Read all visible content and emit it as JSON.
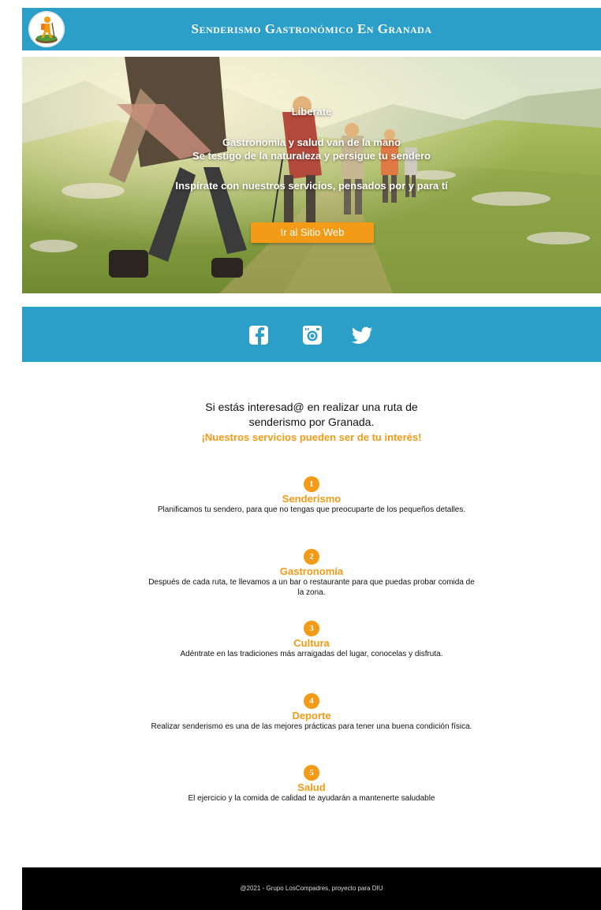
{
  "header": {
    "title": "Senderismo Gastronómico En Granada",
    "logo_icon": "hiker-logo-icon"
  },
  "hero": {
    "line1": "Liberate",
    "line2": "Gastronomía y salud van de la mano",
    "line3": "Se testigo de la naturaleza y persigue tu sendero",
    "line4": "Inspírate con nuestros servicios, pensados por y para tí",
    "button_label": "Ir al Sitio Web"
  },
  "social": {
    "icons": [
      "facebook-icon",
      "instagram-icon",
      "twitter-icon"
    ]
  },
  "intro": {
    "line1": "Si estás interesad@ en realizar una ruta de",
    "line2": "senderismo por Granada.",
    "accent": "¡Nuestros servicios pueden ser de tu interés!"
  },
  "services": [
    {
      "number": "1",
      "title": "Senderismo",
      "desc": "Planificamos tu sendero, para que no tengas que preocuparte de los pequeños detalles."
    },
    {
      "number": "2",
      "title": "Gastronomía",
      "desc": "Después de cada ruta, te llevamos a un bar o restaurante para que puedas probar comida de la zona."
    },
    {
      "number": "3",
      "title": "Cultura",
      "desc": "Adéntrate en las tradiciones más arraigadas del lugar, conocelas y disfruta."
    },
    {
      "number": "4",
      "title": "Deporte",
      "desc": "Realizar senderismo es una de las mejores prácticas para tener una buena condición física."
    },
    {
      "number": "5",
      "title": "Salud",
      "desc": "El ejercicio y la comida de calidad te ayudarán a mantenerte saludable"
    }
  ],
  "footer": {
    "text": "@2021 - Grupo LosCompadres, proyecto para DIU"
  },
  "colors": {
    "primary_blue": "#2c9fc8",
    "accent_orange": "#f39a16",
    "footer_bg": "#000000"
  }
}
